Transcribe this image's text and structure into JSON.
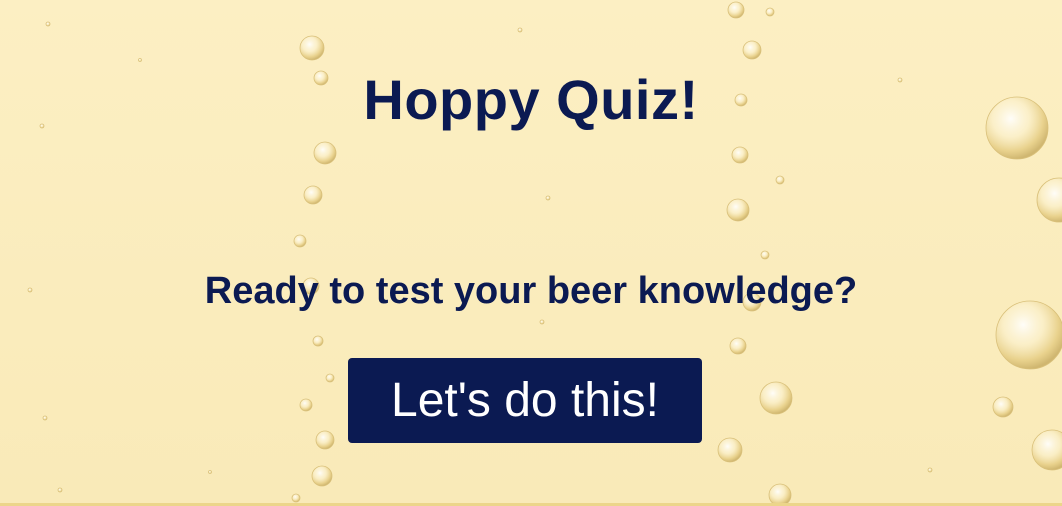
{
  "page": {
    "title": "Hoppy Quiz!",
    "subtitle": "Ready to test your beer knowledge?",
    "start_button_label": "Let's do this!"
  },
  "colors": {
    "background": "#fbeebe",
    "text": "#0b1a52",
    "button_background": "#0b1a52",
    "button_text": "#ffffff"
  },
  "decor": {
    "background_icon": "beer-bubbles-icon"
  }
}
